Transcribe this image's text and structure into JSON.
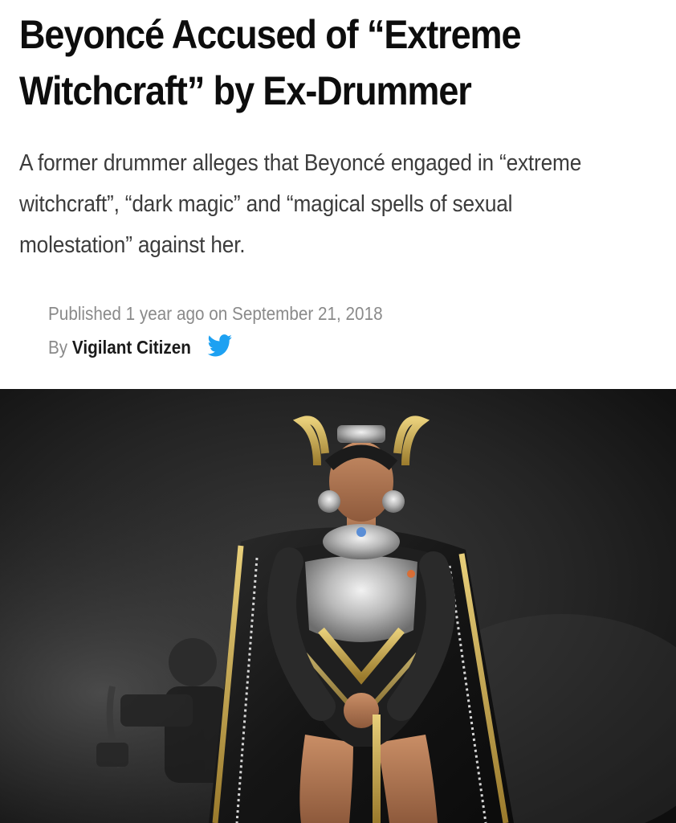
{
  "article": {
    "headline_lines": [
      "Beyoncé Accused of “Extreme",
      "Witchcraft” by Ex-Drummer"
    ],
    "excerpt_lines": [
      "A former drummer alleges that Beyoncé engaged in “extreme",
      "witchcraft”, “dark magic” and “magical spells of sexual",
      "molestation” against her."
    ],
    "published_text": "Published 1 year ago on September 21, 2018",
    "by_label": "By",
    "author": "Vigilant Citizen",
    "social_icon": "twitter-bird-icon",
    "photo_icon": "performer-photo"
  },
  "colors": {
    "headline": "#0d0d0d",
    "excerpt": "#3c3c3c",
    "meta": "#8a8a8a",
    "twitter_blue": "#1da1f2",
    "photo_background": "#151515"
  }
}
